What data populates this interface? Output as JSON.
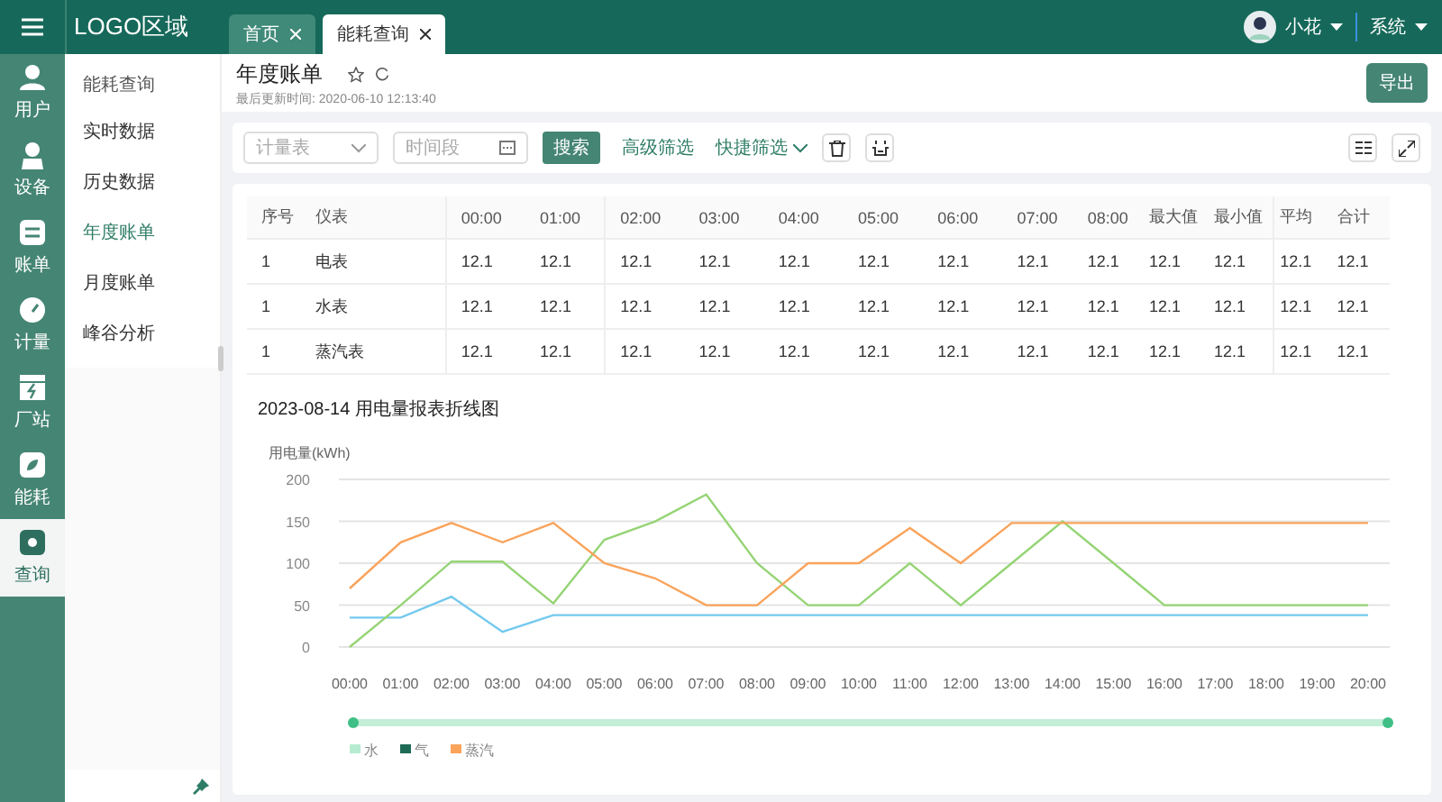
{
  "topbar": {
    "logo": "LOGO区域",
    "user_name": "小花",
    "system_menu": "系统"
  },
  "tabs": [
    {
      "label": "首页",
      "selected": false
    },
    {
      "label": "能耗查询",
      "selected": true
    }
  ],
  "rail": [
    {
      "label": "用户",
      "selected": false
    },
    {
      "label": "设备",
      "selected": false
    },
    {
      "label": "账单",
      "selected": false
    },
    {
      "label": "计量",
      "selected": false
    },
    {
      "label": "厂站",
      "selected": false
    },
    {
      "label": "能耗",
      "selected": false
    },
    {
      "label": "查询",
      "selected": true
    }
  ],
  "submenu": {
    "heading": "能耗查询",
    "items": [
      {
        "label": "实时数据",
        "selected": false
      },
      {
        "label": "历史数据",
        "selected": false
      },
      {
        "label": "年度账单",
        "selected": true
      },
      {
        "label": "月度账单",
        "selected": false
      },
      {
        "label": "峰谷分析",
        "selected": false
      }
    ]
  },
  "page": {
    "title": "年度账单",
    "updated": "最后更新时间: 2020-06-10 12:13:40",
    "export": "导出"
  },
  "toolbar": {
    "meter_placeholder": "计量表",
    "date_placeholder": "时间段",
    "search": "搜索",
    "advanced": "高级筛选",
    "quick": "快捷筛选"
  },
  "table": {
    "columns": [
      "序号",
      "仪表",
      "00:00",
      "01:00",
      "02:00",
      "03:00",
      "04:00",
      "05:00",
      "06:00",
      "07:00",
      "08:00",
      "最大值",
      "最小值",
      "平均",
      "合计"
    ],
    "rows": [
      [
        "1",
        "电表",
        "12.1",
        "12.1",
        "12.1",
        "12.1",
        "12.1",
        "12.1",
        "12.1",
        "12.1",
        "12.1",
        "12.1",
        "12.1",
        "12.1",
        "12.1"
      ],
      [
        "1",
        "水表",
        "12.1",
        "12.1",
        "12.1",
        "12.1",
        "12.1",
        "12.1",
        "12.1",
        "12.1",
        "12.1",
        "12.1",
        "12.1",
        "12.1",
        "12.1"
      ],
      [
        "1",
        "蒸汽表",
        "12.1",
        "12.1",
        "12.1",
        "12.1",
        "12.1",
        "12.1",
        "12.1",
        "12.1",
        "12.1",
        "12.1",
        "12.1",
        "12.1",
        "12.1"
      ]
    ]
  },
  "chart": {
    "chart_data": {
      "type": "line",
      "title": "2023-08-14 用电量报表折线图",
      "ylabel": "用电量(kWh)",
      "categories": [
        "00:00",
        "01:00",
        "02:00",
        "03:00",
        "04:00",
        "05:00",
        "06:00",
        "07:00",
        "08:00",
        "09:00",
        "10:00",
        "11:00",
        "12:00",
        "13:00",
        "14:00",
        "15:00",
        "16:00",
        "17:00",
        "18:00",
        "19:00",
        "20:00"
      ],
      "ylim": [
        0,
        200
      ],
      "yticks": [
        0,
        50,
        100,
        150,
        200
      ],
      "grid": true,
      "series": [
        {
          "color": "#73c9ee",
          "values": [
            35,
            35,
            60,
            18,
            38,
            38,
            38,
            38,
            38,
            38,
            38,
            38,
            38,
            38,
            38,
            38,
            38,
            38,
            38,
            38,
            38
          ]
        },
        {
          "color": "#95d475",
          "values": [
            0,
            50,
            102,
            102,
            52,
            128,
            150,
            182,
            100,
            50,
            50,
            100,
            50,
            100,
            150,
            100,
            50,
            50,
            50,
            50,
            50
          ]
        },
        {
          "color": "#f9a35b",
          "values": [
            70,
            125,
            148,
            125,
            148,
            100,
            82,
            50,
            50,
            100,
            100,
            142,
            100,
            148,
            148,
            148,
            148,
            148,
            148,
            148,
            148
          ]
        }
      ]
    },
    "legend": [
      {
        "label": "水",
        "color": "#b7ebd0"
      },
      {
        "label": "气",
        "color": "#1e6b55"
      },
      {
        "label": "蒸汽",
        "color": "#f9a35b"
      }
    ]
  }
}
